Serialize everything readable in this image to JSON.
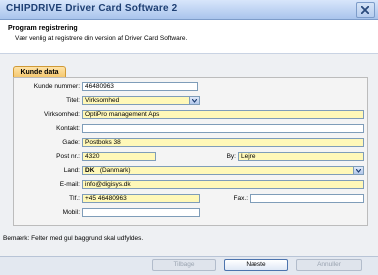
{
  "window": {
    "title": "CHIPDRIVE Driver Card Software 2"
  },
  "header": {
    "title": "Program registrering",
    "subtitle": "Vær venlig at registrere din version af Driver Card Software."
  },
  "tab": {
    "label": "Kunde data"
  },
  "form": {
    "kunde_nummer": {
      "label": "Kunde nummer:",
      "value": "46480963"
    },
    "titel": {
      "label": "Titel:",
      "value": "Virksomhed"
    },
    "virksomhed": {
      "label": "Virksomhed:",
      "value": "OptiPro management Aps"
    },
    "kontakt": {
      "label": "Kontakt:",
      "value": ""
    },
    "gade": {
      "label": "Gade:",
      "value": "Postboks 38"
    },
    "post_nr": {
      "label": "Post nr.:",
      "value": "4320"
    },
    "by": {
      "label": "By:",
      "value": "Lejre"
    },
    "land": {
      "label": "Land:",
      "code": "DK",
      "value": "(Danmark)"
    },
    "email": {
      "label": "E-mail:",
      "value": "info@digisys.dk"
    },
    "tlf": {
      "label": "Tlf.:",
      "value": "+45 46480963"
    },
    "fax": {
      "label": "Fax.:",
      "value": ""
    },
    "mobil": {
      "label": "Mobil:",
      "value": ""
    }
  },
  "note": "Bemærk: Felter med gul baggrund skal udfyldes.",
  "buttons": {
    "back": "Tilbage",
    "next": "Næste",
    "cancel": "Annuller"
  },
  "colors": {
    "required": "#fff8b8",
    "tab": "#f4c56a",
    "title": "#1e3f73"
  },
  "icons": {
    "close": "close-icon",
    "dropdown": "chevron-down-icon"
  }
}
